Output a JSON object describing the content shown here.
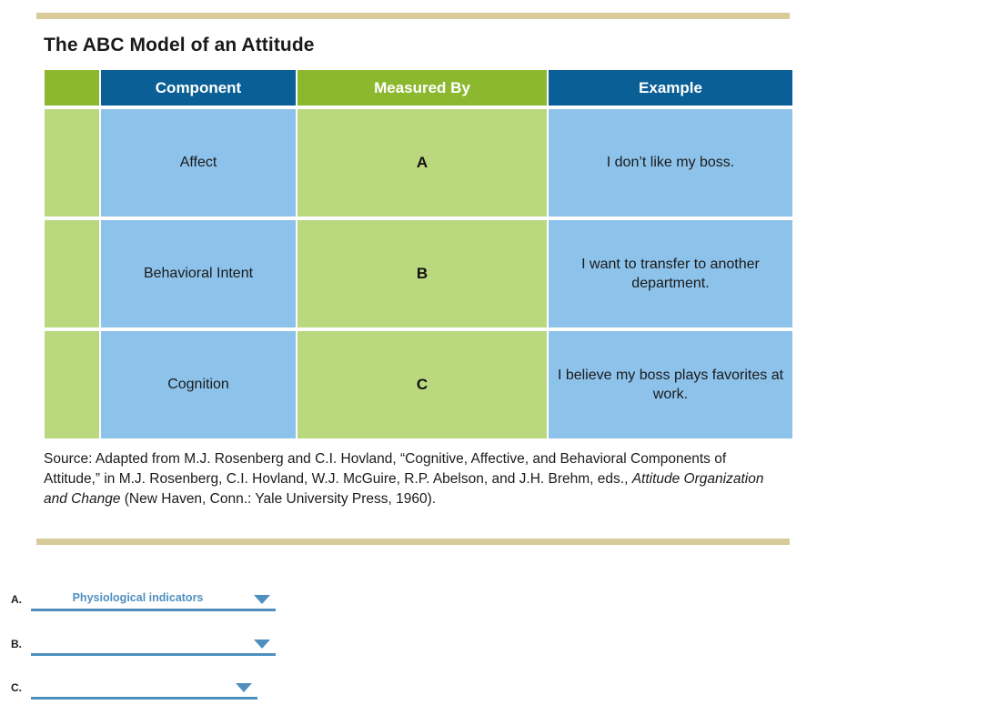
{
  "rules": {
    "color": "#d8cb9a"
  },
  "figure": {
    "title": "The ABC Model of an Attitude",
    "headers": {
      "spacer": "",
      "component": "Component",
      "measured_by": "Measured By",
      "example": "Example"
    },
    "rows": [
      {
        "component": "Affect",
        "measured_by": "A",
        "example": "I don’t like my boss."
      },
      {
        "component": "Behavioral Intent",
        "measured_by": "B",
        "example": "I want to transfer to another department."
      },
      {
        "component": "Cognition",
        "measured_by": "C",
        "example": "I believe my boss plays favorites at work."
      }
    ],
    "source": {
      "part1": "Source: Adapted from M.J. Rosenberg and C.I. Hovland, “Cognitive, Affective, and Behavioral Components of Attitude,” in M.J. Rosenberg, C.I. Hovland, W.J. McGuire, R.P. Abelson, and J.H. Brehm, eds., ",
      "italic": "Attitude Organization and Change",
      "part2": " (New Haven, Conn.: Yale University Press, 1960)."
    },
    "colors": {
      "header_blue": "#0a6096",
      "header_green": "#8cb830",
      "cell_blue": "#8dc2ea",
      "cell_green": "#bad87e"
    }
  },
  "answers": [
    {
      "label": "A.",
      "value": "Physiological indicators"
    },
    {
      "label": "B.",
      "value": ""
    },
    {
      "label": "C.",
      "value": ""
    }
  ],
  "answer_style": {
    "accent": "#4f8fc0"
  }
}
